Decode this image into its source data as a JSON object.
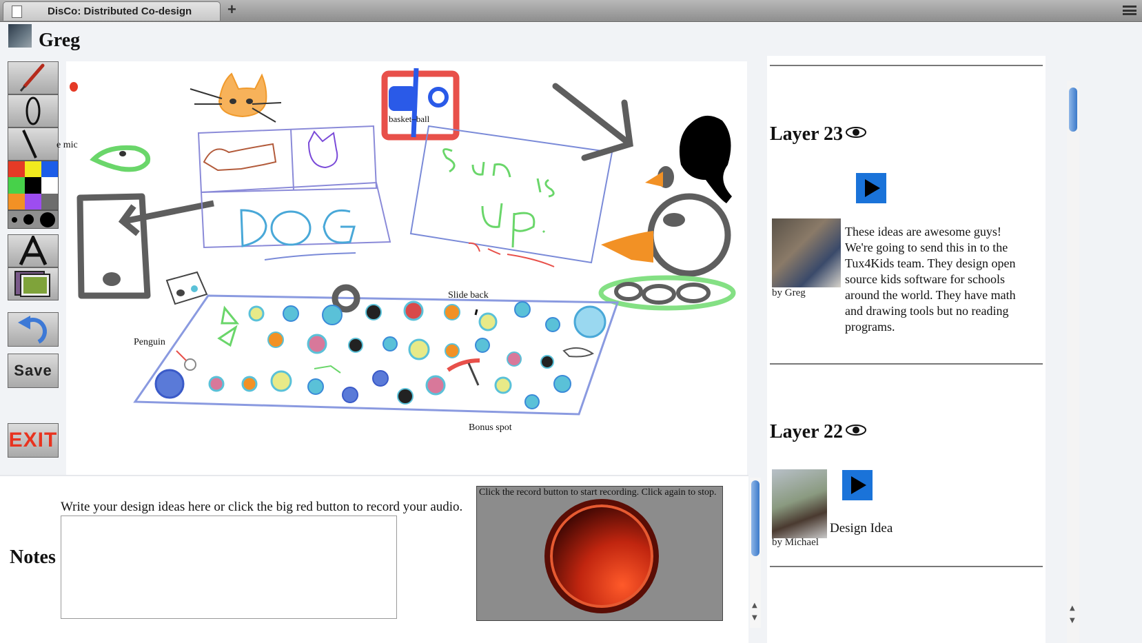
{
  "browser": {
    "tab_title": "DisCo: Distributed Co-design",
    "new_tab_label": "+"
  },
  "user": {
    "name": "Greg"
  },
  "toolbar": {
    "tools": [
      "brush-icon",
      "ellipse-icon",
      "line-icon",
      "text-icon",
      "image-icon",
      "undo-icon"
    ],
    "palette": [
      "#e53a26",
      "#f2ea1e",
      "#1c5de8",
      "#47d14a",
      "#000000",
      "#ffffff",
      "#f29125",
      "#9d4df0",
      "#6d6d6d"
    ],
    "save_label": "Save",
    "exit_label": "EXIT"
  },
  "canvas": {
    "labels": {
      "mic": "e mic",
      "basketball": "basket–ball",
      "slide_back": "Slide back",
      "penguin": "Penguin",
      "bonus_spot": "Bonus spot"
    }
  },
  "notes": {
    "label": "Notes",
    "hint": "Write your design ideas here or click the big red button to record your audio.",
    "value": "",
    "record_hint": "Click the record button to start recording. Click again to stop."
  },
  "layers": [
    {
      "title": "Layer 23",
      "author": "by Greg",
      "text_lines": [
        "These ideas are awesome guys!",
        "We're going to send this in to the",
        "Tux4Kids team. They design open",
        "source kids software for schools",
        "around the world. They have math",
        "and drawing tools but no reading",
        "programs."
      ]
    },
    {
      "title": "Layer 22",
      "author": "by Michael",
      "caption": "Design Idea"
    }
  ],
  "colors": {
    "accent_blue": "#1a73d9",
    "record_red": "#c0250f",
    "exit_red": "#e8331f"
  }
}
